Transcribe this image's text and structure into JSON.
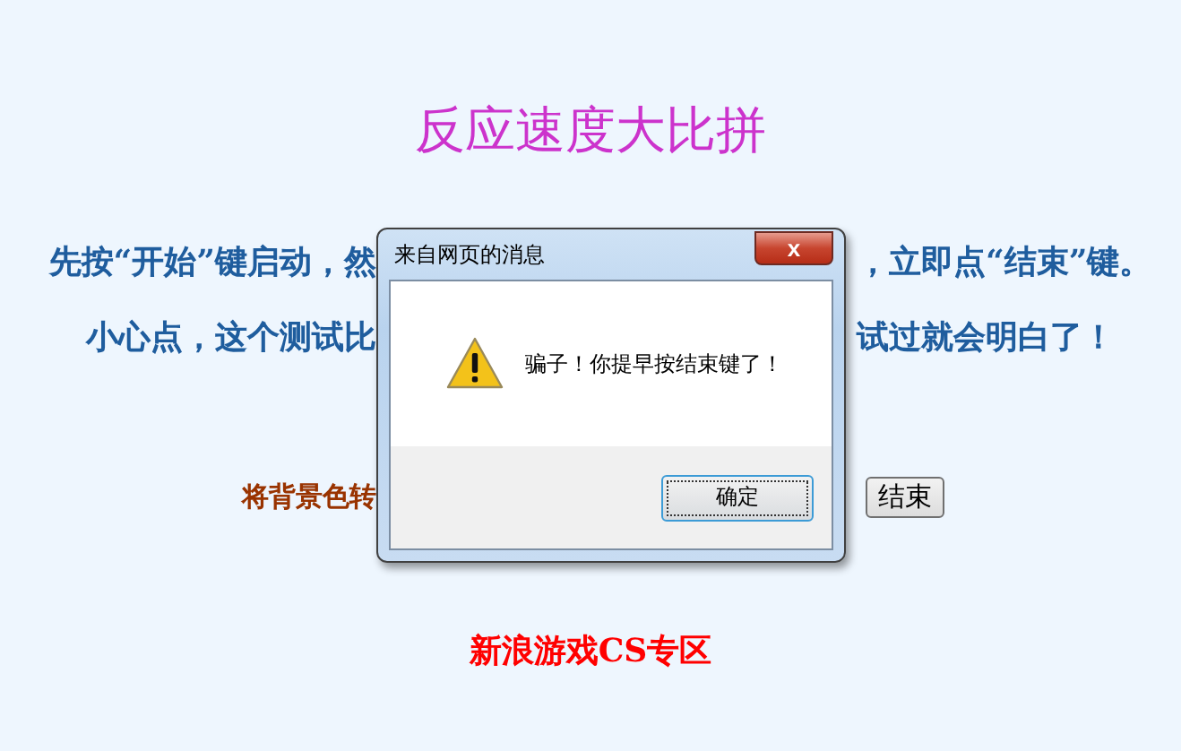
{
  "page": {
    "title": "反应速度大比拼",
    "instruction_lines": [
      {
        "left": "先按“开始”键启动，然",
        "right": "，立即点“结束”键。"
      },
      {
        "left": "小心点，这个测试比",
        "right": "试过就会明白了！"
      }
    ],
    "color_line": {
      "label": "将背景色转",
      "button": "结束"
    },
    "footer_link": "新浪游戏CS专区"
  },
  "dialog": {
    "title": "来自网页的消息",
    "close": "x",
    "message": "骗子！你提早按结束键了！",
    "button": "确定"
  }
}
